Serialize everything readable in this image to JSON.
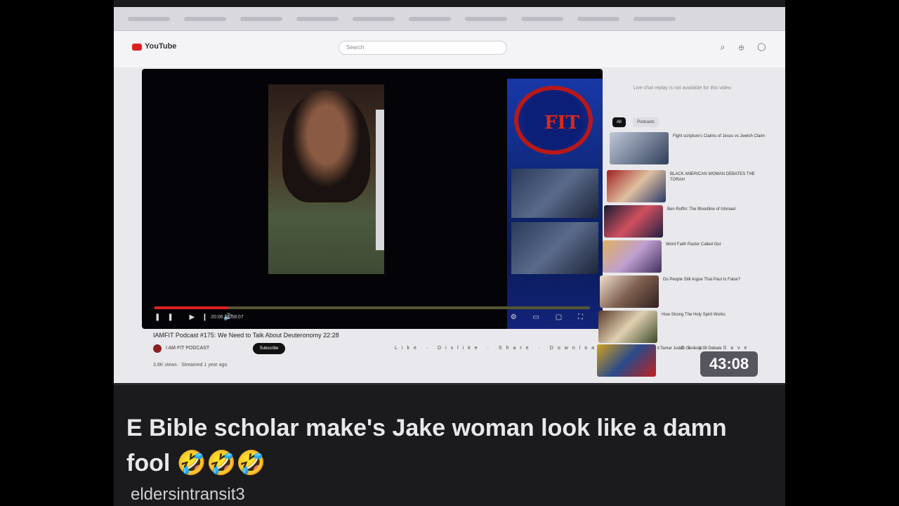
{
  "browser": {
    "yt_logo_text": "YouTube",
    "search_placeholder": "Search"
  },
  "player": {
    "logo_text": "FIT",
    "time_display": "20:06 / 1:58:07",
    "progress_fraction": 0.17
  },
  "video": {
    "small_title": "IAMFIT Podcast #175: We Need to Talk About Deuteronomy 22:28",
    "channel": "I AM FIT PODCAST",
    "subscribe_label": "Subscribe",
    "actions": "Like · Dislike · Share · Download · Thanks · Clip · Save",
    "description": "3.8K views · Streamed 1 year ago"
  },
  "sidebar": {
    "header": "Live chat replay is not available for this video",
    "chips": [
      "All",
      "Podcasts"
    ],
    "recommendations": [
      {
        "title": "Fight scripture's Claims of Jesus vs Jewish Claim"
      },
      {
        "title": "BLACK AMERICAN WOMAN DEBATES THE TORAH"
      },
      {
        "title": "Ben Ruffin: The Bloodline of Ishmael"
      },
      {
        "title": "Word Faith Pastor Called Out"
      },
      {
        "title": "Do People Still Argue That Paul Is False?"
      },
      {
        "title": "How Strong The Holy Spirit Works"
      },
      {
        "title": "Tamar Judah Genesis 38 Debate"
      }
    ]
  },
  "duration_badge": "43:08",
  "card": {
    "title": "E Bible scholar make's Jake woman look like a damn fool 🤣🤣🤣",
    "channel": "eldersintransit3"
  }
}
